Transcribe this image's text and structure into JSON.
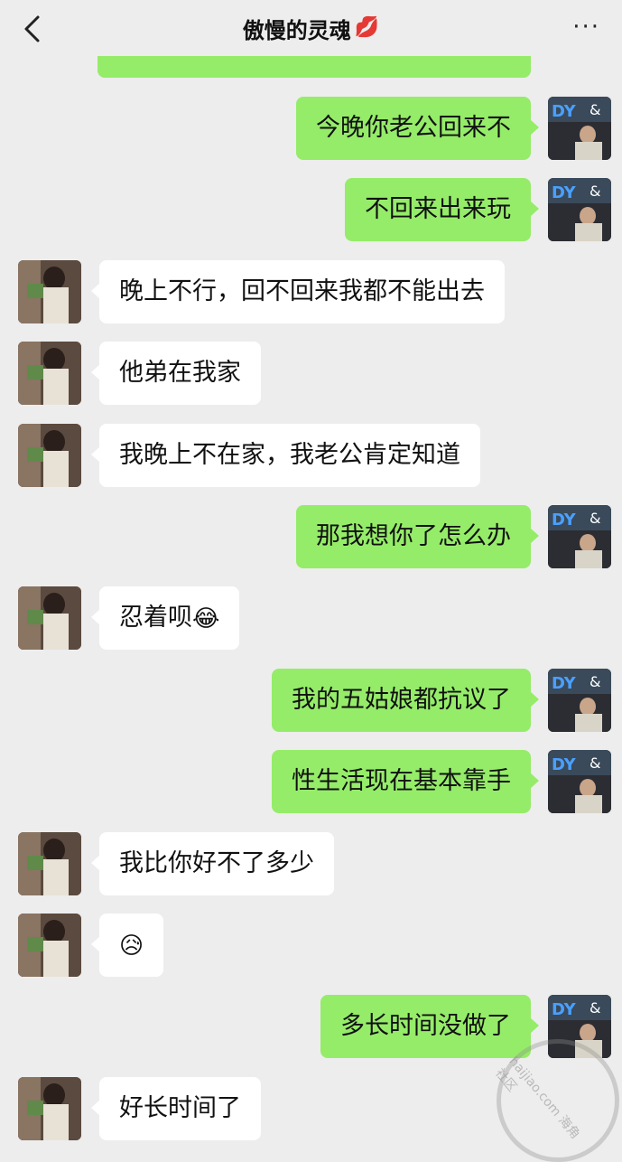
{
  "header": {
    "title": "傲慢的灵魂",
    "title_emoji": "💋",
    "back_icon": "chevron-left-icon",
    "more_label": "···"
  },
  "messages": [
    {
      "from": "me",
      "text": "今晚你老公回来不"
    },
    {
      "from": "me",
      "text": "不回来出来玩"
    },
    {
      "from": "her",
      "text": "晚上不行，回不回来我都不能出去"
    },
    {
      "from": "her",
      "text": "他弟在我家"
    },
    {
      "from": "her",
      "text": "我晚上不在家，我老公肯定知道"
    },
    {
      "from": "me",
      "text": "那我想你了怎么办"
    },
    {
      "from": "her",
      "text": "忍着呗",
      "emoji": "😂"
    },
    {
      "from": "me",
      "text": "我的五姑娘都抗议了"
    },
    {
      "from": "me",
      "text": "性生活现在基本靠手"
    },
    {
      "from": "her",
      "text": "我比你好不了多少"
    },
    {
      "from": "her",
      "text": "",
      "emoji": "😥"
    },
    {
      "from": "me",
      "text": "多长时间没做了"
    },
    {
      "from": "her",
      "text": "好长时间了"
    }
  ],
  "watermark": {
    "text": "haijiao.com 海角社区"
  },
  "colors": {
    "sent_bubble": "#95ec69",
    "received_bubble": "#ffffff",
    "background": "#ededed"
  }
}
